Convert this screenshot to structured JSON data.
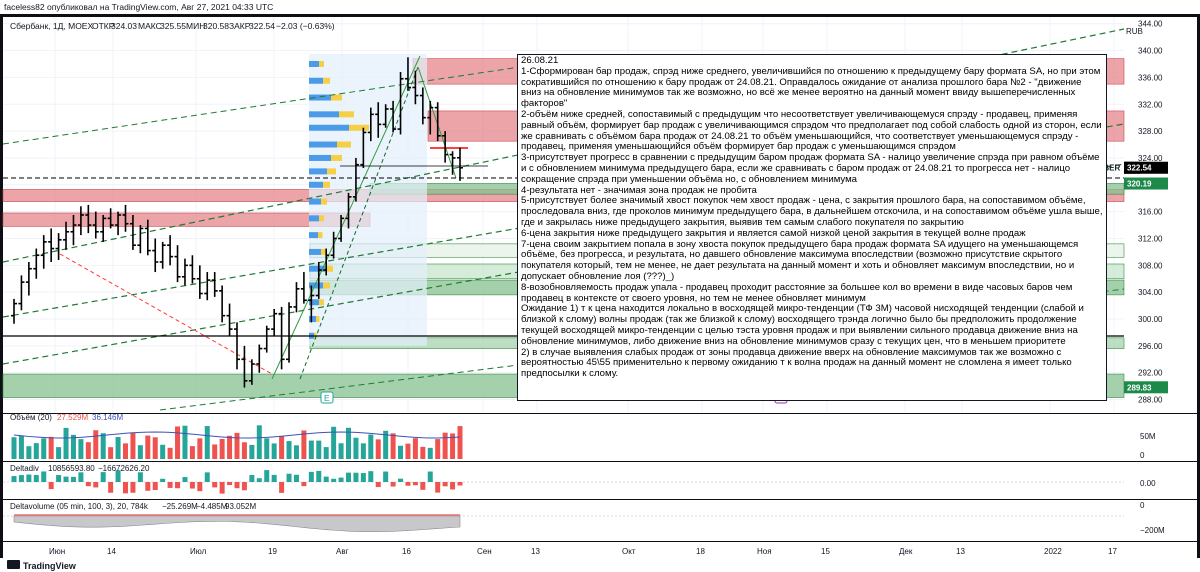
{
  "header": {
    "publisher_line": "faceless82 опубликовал на TradingView.com, Авг 27, 2021 04:33 UTC"
  },
  "legend": {
    "symbol_line": "Сбербанк, 1Д, MOEX",
    "open_label": "ОТКР",
    "open_value": "324.03",
    "high_label": "МАКС",
    "high_value": "325.55",
    "low_label": "МИН",
    "low_value": "320.58",
    "close_label": "ЗАКР",
    "close_value": "322.54",
    "change_value": "−2.03 (−0.63%)"
  },
  "price_axis": {
    "currency": "RUB",
    "ticks": [
      "344.00",
      "340.00",
      "336.00",
      "332.00",
      "328.00",
      "324.00",
      "320.00",
      "316.00",
      "312.00",
      "308.00",
      "304.00",
      "300.00",
      "296.00",
      "292.00",
      "288.00"
    ],
    "symbol_tag": "SBER",
    "last_price": "322.54",
    "marker_price_1": "320.19",
    "marker_price_2": "289.83"
  },
  "time_axis": {
    "ticks": [
      "Июн",
      "14",
      "Июл",
      "19",
      "Авг",
      "16",
      "Сен",
      "13",
      "Окт",
      "18",
      "Ноя",
      "15",
      "Дек",
      "13",
      "2022",
      "17"
    ]
  },
  "event_badges": {
    "earnings": "E",
    "dividends": "E"
  },
  "indicators": {
    "volume": {
      "label": "Объём (20)",
      "value1": "27.529M",
      "value2": "36.146M",
      "axis_ticks": [
        "50M",
        "0"
      ]
    },
    "delta": {
      "label": "Deltadiv",
      "value1": "10856593.80",
      "value2": "−16672626.20",
      "axis_ticks": [
        "0.00"
      ]
    },
    "cumdelta": {
      "label": "Deltavolume (05 min, 100, 3), 20, 784k",
      "value1": "−25.269M",
      "value2": "−4.485M",
      "value3": "93.052M",
      "axis_ticks": [
        "0",
        "−200M"
      ]
    }
  },
  "note": {
    "date": "26.08.21",
    "paragraphs": [
      "1-Сформирован бар продаж, спрэд ниже среднего, увеличившийся по отношению к предыдущему бару формата SA, но при этом сократившийся по отношению к бару продаж от 24.08.21. Оправдалось ожидание от анализа прошлого бара №2 - \"движение вниз на обновление минимумов так же возможно, но всё же менее вероятно на данный момент ввиду вышеперечисленных факторов\"",
      "2-объём ниже средней, сопоставимый с предыдущим что несоответствует увеличивающемуся спрэду - продавец, применяя равный объём, формирует бар продаж с увеличивающимся спрэдом что предполагает под собой слабость одной из сторон, если же сравнивать с объёмом бара продаж от 24.08.21 то объём уменьшающийся, что соответствует уменьшающемуся спрэду - продавец, применяя уменьшающийся объём формирует бар продаж с уменьшающимся спрэдом",
      "3-присутствует прогресс в сравнении с предыдущим баром продаж формата SA - налицо увеличение спрэда при равном объёме и с обновлением минимума предыдущего бара, если же сравнивать с баром продаж от 24.08.21 то прогресса нет - налицо сокращение спрэда при уменьшении объёма но, с обновлением минимума",
      "4-результата нет - значимая зона продаж не пробита",
      "5-присутствует более значимый хвост покупок чем хвост продаж - цена, с закрытия прошлого бара, на сопоставимом объёме, проследовала вниз, где проколов минимум предыдущего бара, в дальнейшем отскочила, и на сопоставимом объёме ушла выше, где и закрылась ниже предыдущего закрытия, выявив тем самым слабого покупателя по закрытию",
      "6-цена закрытия ниже предыдущего закрытия и является самой низкой ценой закрытия в текущей волне продаж",
      "7-цена своим закрытием попала в зону хвоста покупок предыдущего бара продаж формата SA идущего на уменьшающемся объёме, без прогресса, и результата, но давшего обновление максимума впоследствии (возможно присутствие скрытого покупателя который, тем не менее, не дает результата на данный момент и хоть и обновляет максимум впоследствии, но и допускает обновление лоя (???)_)",
      "8-возобновляемость продаж упала - продавец проходит расстояние за большее кол во времени в виде часовых баров чем продавец в контексте от своего уровня, но тем не менее обновляет минимум",
      "Ожидание 1) т к цена находится локально в восходящей микро-тенденции (ТФ 3М) часовой нисходящей тенденции (слабой и близкой к слому) волны продаж (так же близкой к слому) восходящего трэнда логично было бы предположить продолжение текущей восходящей микро-тенденции с целью тэста уровня продаж и при выявлении сильного продавца движение вниз на обновление минимумов, либо движение вниз на обновление минимумов сразу с текущих цен, что в меньшем приоритете",
      "2) в случае выявления слабых продаж от зоны продавца движение вверх на обновление максимумов так же возможно с вероятностью 45\\55 применительно к первому ожиданию т к волна продаж на данный момент не сломлена я имеет только предпосылки к слому."
    ]
  },
  "footer": {
    "brand": "TradingView"
  },
  "colors": {
    "background": "#0e0f14",
    "candle": "#000000",
    "sell_zone": "#e5868b",
    "buy_zone": "#86c18f",
    "volume_up": "#26a69a",
    "volume_down": "#ef5350",
    "channel": "#1e7b34",
    "trend_red": "#ff3b30",
    "note_bg": "#ffffff",
    "price_tag": "#1d8a4a",
    "sber_tag": "#000000"
  },
  "chart_data": {
    "type": "candlestick",
    "instrument": "Сбербанк, 1Д, MOEX",
    "y_axis_range": [
      286,
      345
    ],
    "x_range": [
      "Июн",
      "2022 17"
    ],
    "sell_zones": [
      [
        335.0,
        338.8
      ],
      [
        326.5,
        331.0
      ],
      [
        317.5,
        319.3
      ],
      [
        313.8,
        315.8
      ]
    ],
    "buy_zones": [
      [
        318.6,
        320.2
      ],
      [
        309.2,
        311.2
      ],
      [
        306.0,
        308.2
      ],
      [
        303.6,
        305.8
      ],
      [
        295.6,
        297.2
      ],
      [
        288.3,
        291.8
      ]
    ],
    "horizontal_levels": [
      320.19,
      296.5
    ],
    "ohlc": [
      [
        300.5,
        303.0,
        299.3,
        302.3
      ],
      [
        302.3,
        306.5,
        301.3,
        305.5
      ],
      [
        305.5,
        308.5,
        303.5,
        307.5
      ],
      [
        307.5,
        310.5,
        306.0,
        309.5
      ],
      [
        309.5,
        312.5,
        307.5,
        311.5
      ],
      [
        311.5,
        313.5,
        308.5,
        310.5
      ],
      [
        310.5,
        312.8,
        308.8,
        311.8
      ],
      [
        311.8,
        314.5,
        310.3,
        313.0
      ],
      [
        313.0,
        315.5,
        311.0,
        314.0
      ],
      [
        314.0,
        316.8,
        312.5,
        315.5
      ],
      [
        315.5,
        317.0,
        312.8,
        314.0
      ],
      [
        314.0,
        316.0,
        312.0,
        313.0
      ],
      [
        313.0,
        315.5,
        311.5,
        315.0
      ],
      [
        315.0,
        316.5,
        313.5,
        314.0
      ],
      [
        314.0,
        316.0,
        312.5,
        315.5
      ],
      [
        315.5,
        317.0,
        313.0,
        314.2
      ],
      [
        314.2,
        315.5,
        310.3,
        311.0
      ],
      [
        311.0,
        314.0,
        309.8,
        313.5
      ],
      [
        313.5,
        314.8,
        309.5,
        310.2
      ],
      [
        310.2,
        312.0,
        307.0,
        308.5
      ],
      [
        308.5,
        311.5,
        307.5,
        311.0
      ],
      [
        311.0,
        312.5,
        308.0,
        309.3
      ],
      [
        309.3,
        311.0,
        305.5,
        306.3
      ],
      [
        306.3,
        309.0,
        305.0,
        308.0
      ],
      [
        308.0,
        309.5,
        305.3,
        306.0
      ],
      [
        306.0,
        308.0,
        303.0,
        303.8
      ],
      [
        303.8,
        307.0,
        302.8,
        305.8
      ],
      [
        305.8,
        307.0,
        303.3,
        304.2
      ],
      [
        304.2,
        305.0,
        299.5,
        300.5
      ],
      [
        300.5,
        302.3,
        297.5,
        298.5
      ],
      [
        298.5,
        299.5,
        292.5,
        294.0
      ],
      [
        294.0,
        296.0,
        289.8,
        290.8
      ],
      [
        290.8,
        294.0,
        290.2,
        293.3
      ],
      [
        293.3,
        296.2,
        292.0,
        295.6
      ],
      [
        295.6,
        299.0,
        295.0,
        298.5
      ],
      [
        298.5,
        301.5,
        297.5,
        300.8
      ],
      [
        300.8,
        301.8,
        292.5,
        294.0
      ],
      [
        294.0,
        302.5,
        293.5,
        301.8
      ],
      [
        301.8,
        305.5,
        301.0,
        304.5
      ],
      [
        304.5,
        307.0,
        302.3,
        302.8
      ],
      [
        302.8,
        305.0,
        299.5,
        303.5
      ],
      [
        303.5,
        308.5,
        303.0,
        307.3
      ],
      [
        307.3,
        310.5,
        306.5,
        309.5
      ],
      [
        309.5,
        313.0,
        309.0,
        312.0
      ],
      [
        312.0,
        315.5,
        311.5,
        315.0
      ],
      [
        315.0,
        318.8,
        313.5,
        318.2
      ],
      [
        318.2,
        324.0,
        317.5,
        323.0
      ],
      [
        323.0,
        328.5,
        322.5,
        327.8
      ],
      [
        327.8,
        331.5,
        326.5,
        330.5
      ],
      [
        330.5,
        332.3,
        327.0,
        329.0
      ],
      [
        329.0,
        332.0,
        328.5,
        331.3
      ],
      [
        331.3,
        332.5,
        327.8,
        328.3
      ],
      [
        328.3,
        336.8,
        327.5,
        335.8
      ],
      [
        335.8,
        339.0,
        334.0,
        334.5
      ],
      [
        334.5,
        337.0,
        332.0,
        333.3
      ],
      [
        333.3,
        334.5,
        329.0,
        330.0
      ],
      [
        330.0,
        332.5,
        327.5,
        331.5
      ],
      [
        331.5,
        332.3,
        326.5,
        327.3
      ],
      [
        327.3,
        328.0,
        323.3,
        324.5
      ],
      [
        324.5,
        325.0,
        321.5,
        324.0
      ],
      [
        324.03,
        325.55,
        320.58,
        322.54
      ]
    ]
  }
}
